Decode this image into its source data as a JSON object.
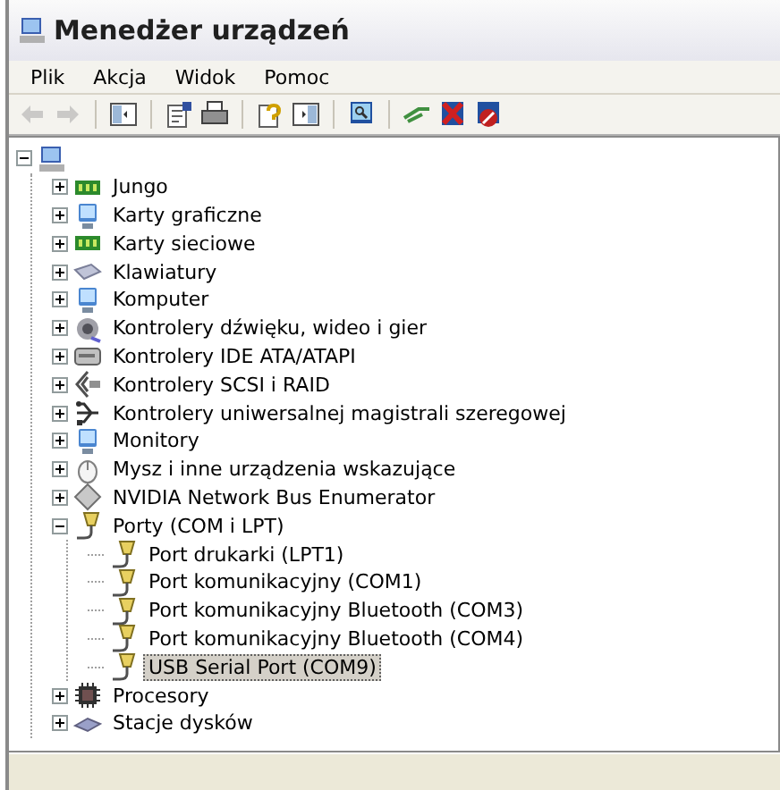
{
  "window": {
    "title": "Menedżer urządzeń"
  },
  "menu": [
    {
      "label": "Plik"
    },
    {
      "label": "Akcja"
    },
    {
      "label": "Widok"
    },
    {
      "label": "Pomoc"
    }
  ],
  "toolbar": [
    {
      "kind": "back",
      "disabled": true
    },
    {
      "kind": "forward",
      "disabled": true
    },
    {
      "kind": "separator"
    },
    {
      "kind": "panel",
      "disabled": false
    },
    {
      "kind": "separator"
    },
    {
      "kind": "properties",
      "disabled": false
    },
    {
      "kind": "print",
      "disabled": false
    },
    {
      "kind": "separator"
    },
    {
      "kind": "help",
      "disabled": false
    },
    {
      "kind": "panel2",
      "disabled": false
    },
    {
      "kind": "separator"
    },
    {
      "kind": "scan",
      "disabled": false
    },
    {
      "kind": "separator"
    },
    {
      "kind": "update",
      "disabled": false
    },
    {
      "kind": "uninstall",
      "disabled": false
    },
    {
      "kind": "disable",
      "disabled": false
    }
  ],
  "tree": [
    {
      "kind": "computer",
      "expanded": true,
      "selected": false,
      "children": [
        {
          "label": "Jungo",
          "kind": "board",
          "expanded": false,
          "selected": false
        },
        {
          "label": "Karty graficzne",
          "kind": "display",
          "expanded": false,
          "selected": false
        },
        {
          "label": "Karty sieciowe",
          "kind": "board",
          "expanded": false,
          "selected": false
        },
        {
          "label": "Klawiatury",
          "kind": "keyboard",
          "expanded": false,
          "selected": false
        },
        {
          "label": "Komputer",
          "kind": "display",
          "expanded": false,
          "selected": false
        },
        {
          "label": "Kontrolery dźwięku, wideo i gier",
          "kind": "speaker",
          "expanded": false,
          "selected": false
        },
        {
          "label": "Kontrolery IDE ATA/ATAPI",
          "kind": "drive",
          "expanded": false,
          "selected": false
        },
        {
          "label": "Kontrolery SCSI i RAID",
          "kind": "scsi",
          "expanded": false,
          "selected": false
        },
        {
          "label": "Kontrolery uniwersalnej magistrali szeregowej",
          "kind": "usb",
          "expanded": false,
          "selected": false
        },
        {
          "label": "Monitory",
          "kind": "display",
          "expanded": false,
          "selected": false
        },
        {
          "label": "Mysz i inne urządzenia wskazujące",
          "kind": "mouse",
          "expanded": false,
          "selected": false
        },
        {
          "label": "NVIDIA Network Bus Enumerator",
          "kind": "diamond",
          "expanded": false,
          "selected": false
        },
        {
          "label": "Porty (COM i LPT)",
          "kind": "port",
          "expanded": true,
          "selected": false,
          "children": [
            {
              "label": "Port drukarki (LPT1)",
              "kind": "port",
              "selected": false
            },
            {
              "label": "Port komunikacyjny (COM1)",
              "kind": "port",
              "selected": false
            },
            {
              "label": "Port komunikacyjny Bluetooth (COM3)",
              "kind": "port",
              "selected": false
            },
            {
              "label": "Port komunikacyjny Bluetooth (COM4)",
              "kind": "port",
              "selected": false
            },
            {
              "label": "USB Serial Port (COM9)",
              "kind": "port",
              "selected": true
            }
          ]
        },
        {
          "label": "Procesory",
          "kind": "chip",
          "expanded": false,
          "selected": false
        },
        {
          "label": "Stacje dysków",
          "kind": "disk",
          "expanded": false,
          "selected": false
        }
      ]
    }
  ]
}
